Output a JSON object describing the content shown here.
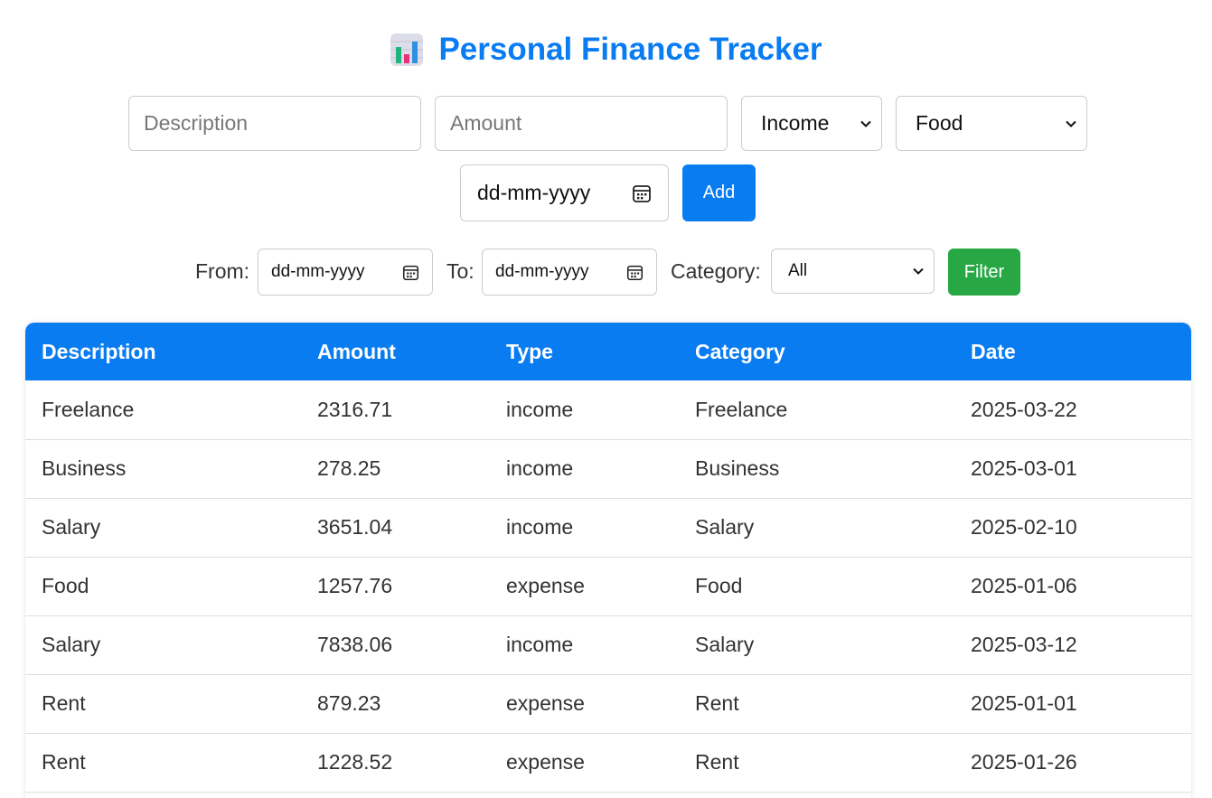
{
  "header": {
    "icon": "bar-chart-icon",
    "title": "Personal Finance Tracker"
  },
  "add_form": {
    "description_placeholder": "Description",
    "amount_placeholder": "Amount",
    "type_selected": "Income",
    "category_selected": "Food",
    "date_placeholder": "dd-mm-yyyy",
    "add_label": "Add"
  },
  "filter": {
    "from_label": "From:",
    "from_placeholder": "dd-mm-yyyy",
    "to_label": "To:",
    "to_placeholder": "dd-mm-yyyy",
    "category_label": "Category:",
    "category_selected": "All",
    "filter_label": "Filter"
  },
  "table": {
    "headers": [
      "Description",
      "Amount",
      "Type",
      "Category",
      "Date"
    ],
    "rows": [
      [
        "Freelance",
        "2316.71",
        "income",
        "Freelance",
        "2025-03-22"
      ],
      [
        "Business",
        "278.25",
        "income",
        "Business",
        "2025-03-01"
      ],
      [
        "Salary",
        "3651.04",
        "income",
        "Salary",
        "2025-02-10"
      ],
      [
        "Food",
        "1257.76",
        "expense",
        "Food",
        "2025-01-06"
      ],
      [
        "Salary",
        "7838.06",
        "income",
        "Salary",
        "2025-03-12"
      ],
      [
        "Rent",
        "879.23",
        "expense",
        "Rent",
        "2025-01-01"
      ],
      [
        "Rent",
        "1228.52",
        "expense",
        "Rent",
        "2025-01-26"
      ]
    ]
  },
  "colors": {
    "primary": "#0a7cf2",
    "filter_button": "#28a745"
  }
}
